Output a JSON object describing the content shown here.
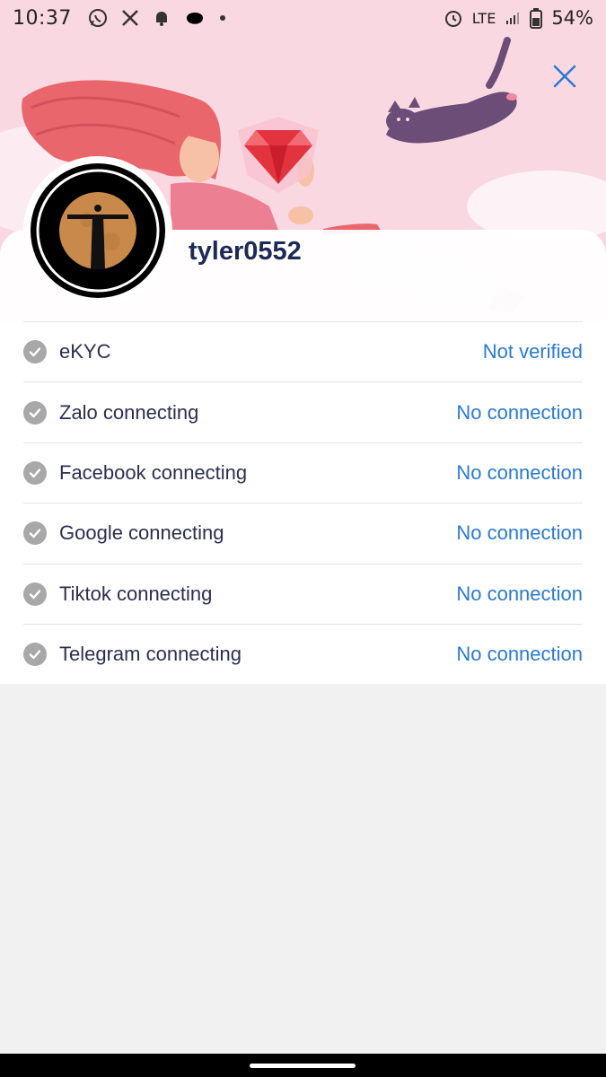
{
  "status_bar": {
    "time": "10:37",
    "network": "LTE",
    "battery": "54%",
    "icons_left": [
      "whatsapp-icon",
      "x-icon",
      "bell-icon",
      "app-icon",
      "dot-icon"
    ],
    "icons_right": [
      "alarm-icon",
      "signal-icon",
      "battery-icon"
    ]
  },
  "profile": {
    "username": "tyler0552"
  },
  "rows": [
    {
      "label": "eKYC",
      "status": "Not verified"
    },
    {
      "label": "Zalo connecting",
      "status": "No connection"
    },
    {
      "label": "Facebook connecting",
      "status": "No connection"
    },
    {
      "label": "Google connecting",
      "status": "No connection"
    },
    {
      "label": "Tiktok connecting",
      "status": "No connection"
    },
    {
      "label": "Telegram connecting",
      "status": "No connection"
    }
  ],
  "colors": {
    "hero_bg": "#f9d8e2",
    "link": "#2a7ad1",
    "username": "#1c2a55",
    "close_icon": "#2a7ad1"
  }
}
